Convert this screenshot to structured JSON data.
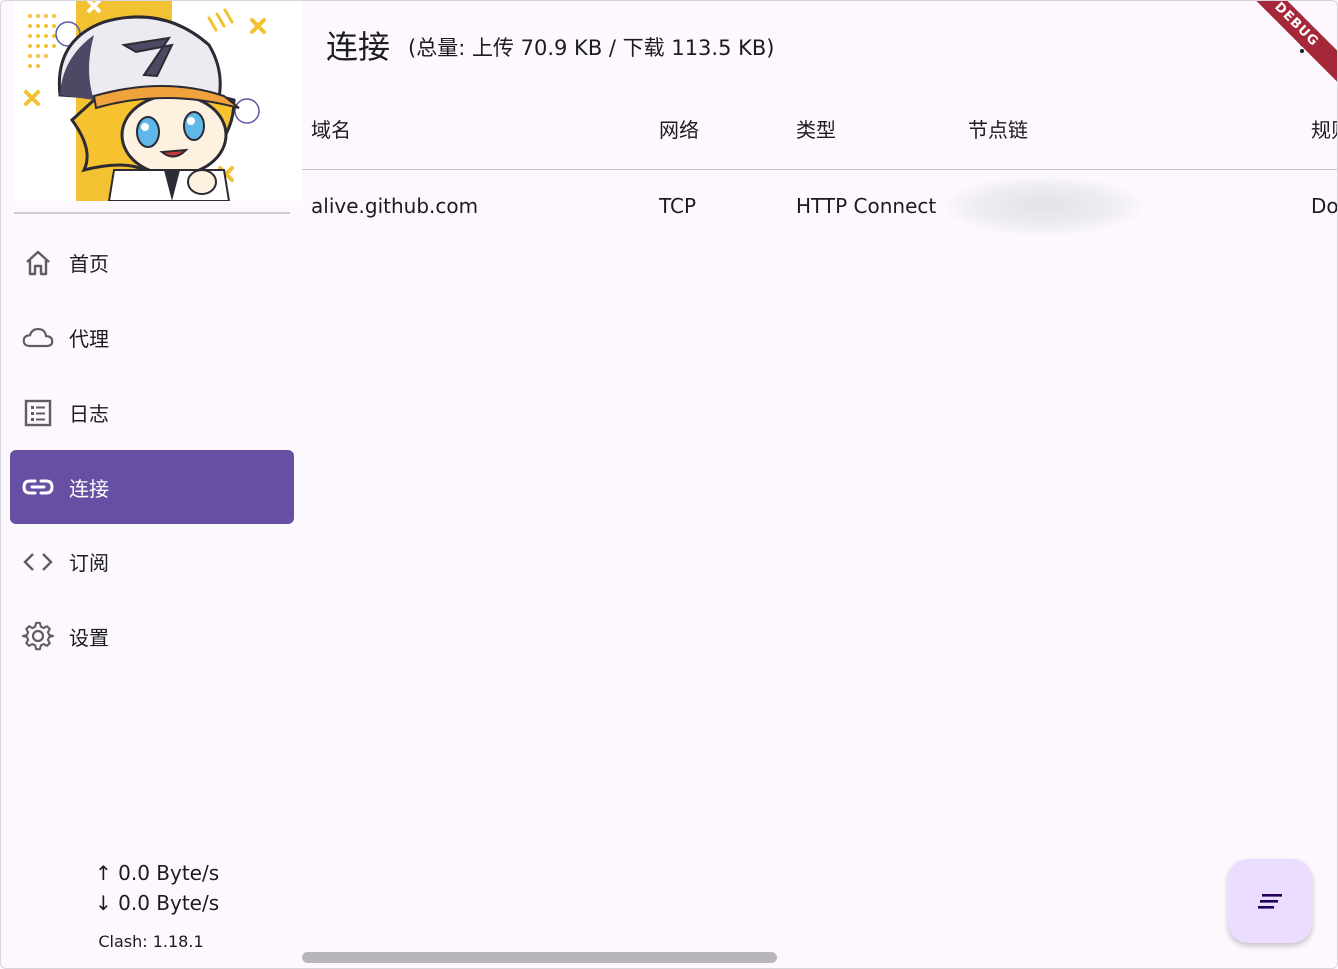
{
  "sidebar": {
    "items": [
      {
        "label": "首页",
        "icon": "home-icon"
      },
      {
        "label": "代理",
        "icon": "cloud-icon"
      },
      {
        "label": "日志",
        "icon": "list-icon"
      },
      {
        "label": "连接",
        "icon": "link-icon",
        "active": true
      },
      {
        "label": "订阅",
        "icon": "code-icon"
      },
      {
        "label": "设置",
        "icon": "gear-icon"
      }
    ],
    "upload_speed": "↑ 0.0 Byte/s",
    "download_speed": "↓ 0.0 Byte/s",
    "version": "Clash: 1.18.1"
  },
  "header": {
    "title": "连接",
    "subtitle": "(总量: 上传 70.9 KB / 下载 113.5 KB)"
  },
  "debug_banner": "DEBUG",
  "table": {
    "columns": [
      "域名",
      "网络",
      "类型",
      "节点链",
      "规则"
    ],
    "rows": [
      {
        "domain": "alive.github.com",
        "network": "TCP",
        "type": "HTTP Connect",
        "chain": "",
        "rule": "Do"
      }
    ]
  },
  "fab": {
    "icon": "sort-icon"
  },
  "colors": {
    "accent": "#6750a4",
    "fab": "#eaddff",
    "background": "#fcf8fd"
  }
}
